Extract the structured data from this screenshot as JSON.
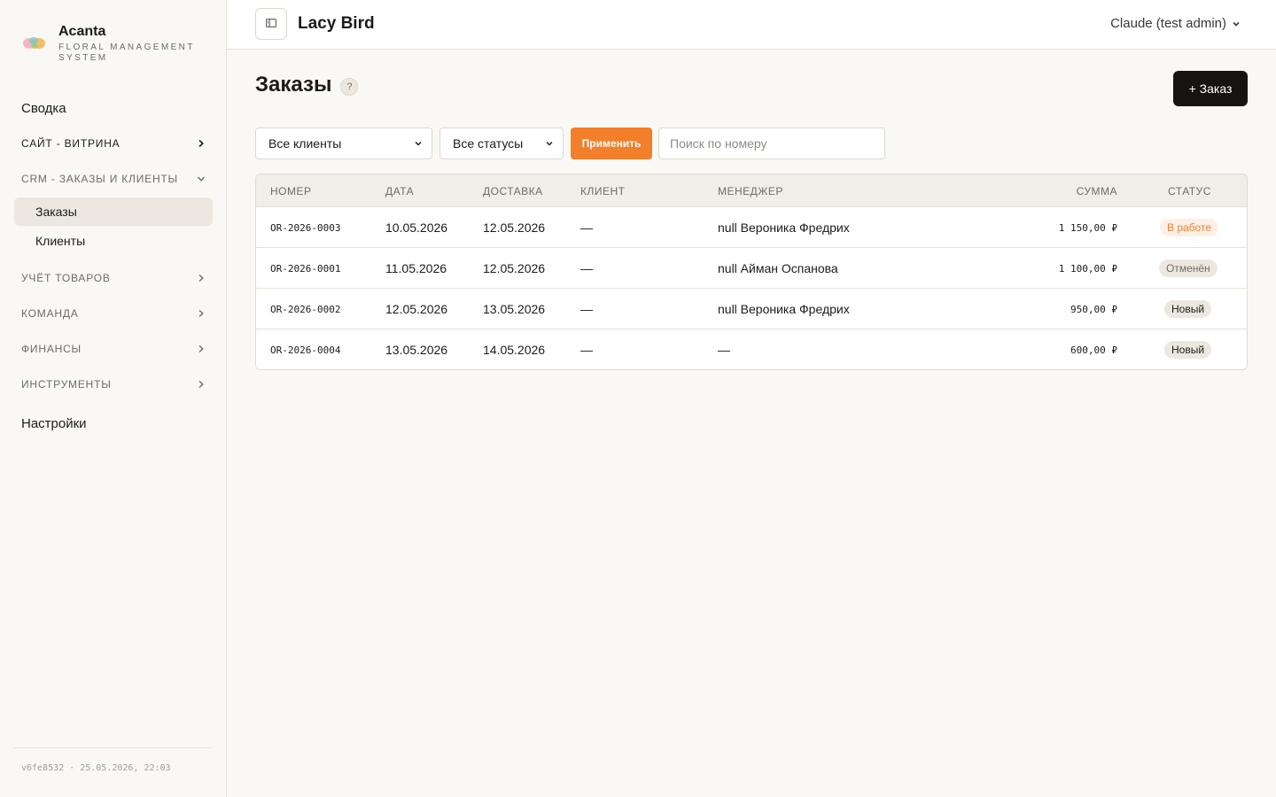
{
  "brand": {
    "name": "Acanta",
    "subtitle": "FLORAL MANAGEMENT SYSTEM"
  },
  "sidebar": {
    "items": [
      {
        "label": "Сводка",
        "kind": "plain"
      },
      {
        "label": "САЙТ - ВИТРИНА",
        "kind": "section",
        "chevron": "right"
      },
      {
        "label": "CRM - ЗАКАЗЫ И КЛИЕНТЫ",
        "kind": "section",
        "chevron": "down",
        "children": [
          {
            "label": "Заказы",
            "active": true
          },
          {
            "label": "Клиенты",
            "active": false
          }
        ]
      },
      {
        "label": "УЧЁТ ТОВАРОВ",
        "kind": "section",
        "chevron": "right"
      },
      {
        "label": "КОМАНДА",
        "kind": "section",
        "chevron": "right"
      },
      {
        "label": "ФИНАНСЫ",
        "kind": "section",
        "chevron": "right"
      },
      {
        "label": "ИНСТРУМЕНТЫ",
        "kind": "section",
        "chevron": "right"
      },
      {
        "label": "Настройки",
        "kind": "plain"
      }
    ],
    "version": "v6fe8532 · 25.05.2026, 22:03"
  },
  "header": {
    "shop_name": "Lacy Bird",
    "user": "Claude (test admin)"
  },
  "page": {
    "title": "Заказы",
    "help": "?",
    "add_button": "+ Заказ"
  },
  "filters": {
    "clients_select": "Все клиенты",
    "status_select": "Все статусы",
    "apply_label": "Применить",
    "search_placeholder": "Поиск по номеру"
  },
  "table": {
    "columns": [
      "НОМЕР",
      "ДАТА",
      "ДОСТАВКА",
      "КЛИЕНТ",
      "МЕНЕДЖЕР",
      "СУММА",
      "СТАТУС"
    ],
    "rows": [
      {
        "number": "OR-2026-0003",
        "date": "10.05.2026",
        "delivery": "12.05.2026",
        "client": "—",
        "manager": "null Вероника Фредрих",
        "amount": "1 150,00 ₽",
        "status": "В работе",
        "status_kind": "in_progress"
      },
      {
        "number": "OR-2026-0001",
        "date": "11.05.2026",
        "delivery": "12.05.2026",
        "client": "—",
        "manager": "null Айман Оспанова",
        "amount": "1 100,00 ₽",
        "status": "Отменён",
        "status_kind": "cancelled"
      },
      {
        "number": "OR-2026-0002",
        "date": "12.05.2026",
        "delivery": "13.05.2026",
        "client": "—",
        "manager": "null Вероника Фредрих",
        "amount": "950,00 ₽",
        "status": "Новый",
        "status_kind": "new"
      },
      {
        "number": "OR-2026-0004",
        "date": "13.05.2026",
        "delivery": "14.05.2026",
        "client": "—",
        "manager": "—",
        "amount": "600,00 ₽",
        "status": "Новый",
        "status_kind": "new"
      }
    ]
  },
  "colors": {
    "accent_orange": "#f27f2a",
    "primary_dark": "#151412",
    "status_in_progress_bg": "#fdf0e4",
    "status_in_progress_fg": "#e8803a",
    "status_cancelled_bg": "#ece8df",
    "status_cancelled_fg": "#6e6b66",
    "status_new_bg": "#ece8df",
    "status_new_fg": "#1c1b19"
  },
  "icons": {
    "logo": "acanta-flower-logo",
    "toggle": "sidebar-toggle-icon",
    "chevron_right": "chevron-right-icon",
    "chevron_down": "chevron-down-icon"
  }
}
